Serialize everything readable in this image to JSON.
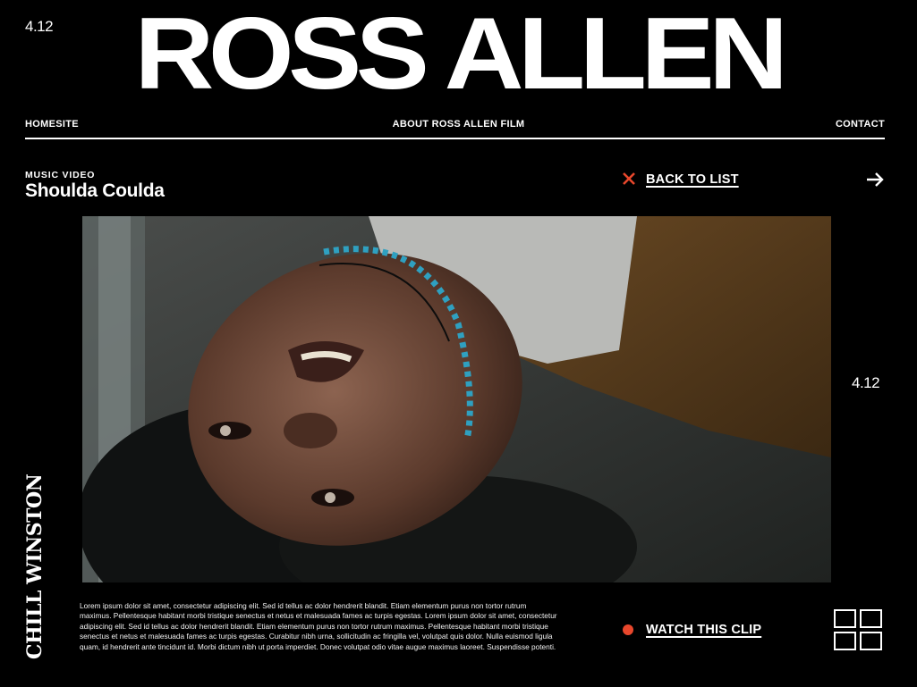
{
  "header": {
    "date_left": "4.12",
    "brand": "ROSS ALLEN",
    "nav": {
      "home": "HOMESITE",
      "about": "ABOUT ROSS ALLEN FILM",
      "contact": "CONTACT"
    }
  },
  "project": {
    "category": "MUSIC VIDEO",
    "title": "Shoulda Coulda",
    "back_label": "BACK TO LIST",
    "date_side": "4.12",
    "client_logo": "CHILL WINSTON",
    "description": "Lorem ipsum dolor sit amet, consectetur adipiscing elit. Sed id tellus ac dolor hendrerit blandit. Etiam elementum purus non tortor rutrum maximus. Pellentesque habitant morbi tristique senectus et netus et malesuada fames ac turpis egestas. Lorem ipsum dolor sit amet, consectetur adipiscing elit. Sed id tellus ac dolor hendrerit blandit. Etiam elementum purus non tortor rutrum maximus. Pellentesque habitant morbi tristique senectus et netus et malesuada fames ac turpis egestas. Curabitur nibh urna, sollicitudin ac fringilla vel, volutpat quis dolor. Nulla euismod ligula quam, id hendrerit ante tincidunt id. Morbi dictum nibh ut porta imperdiet. Donec volutpat odio vitae augue maximus laoreet. Suspendisse potenti.",
    "watch_label": "WATCH THIS CLIP"
  },
  "icons": {
    "back": "close-x-icon",
    "next": "arrow-right-icon",
    "watch": "dot-icon",
    "grid": "grid-view-icon"
  },
  "colors": {
    "background": "#000000",
    "text": "#ffffff",
    "accent": "#e8472c"
  }
}
